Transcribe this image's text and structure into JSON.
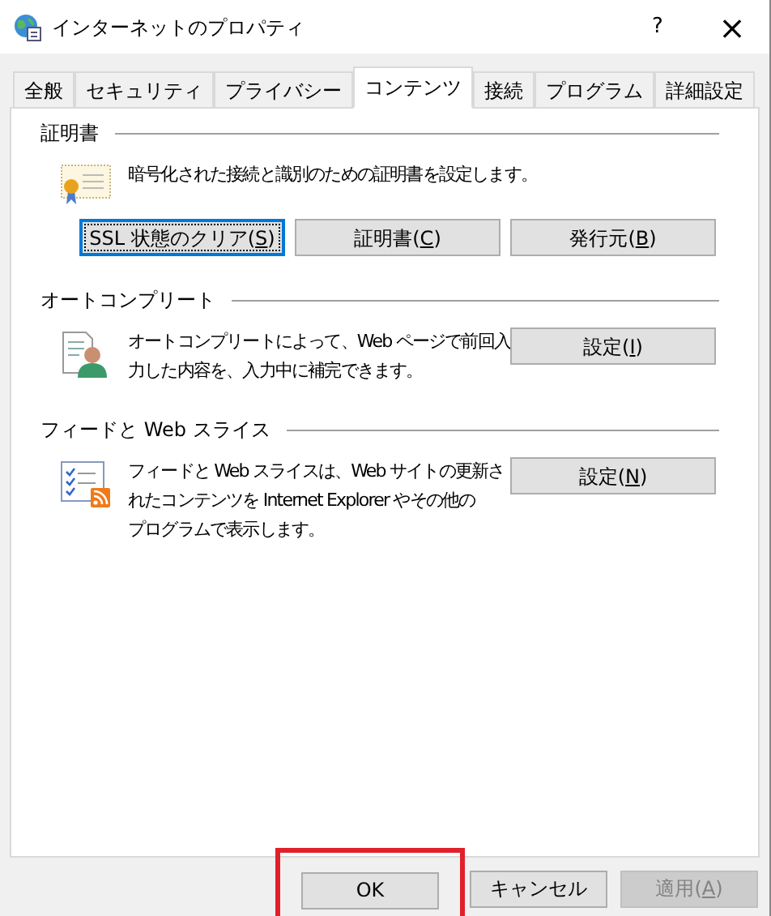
{
  "window": {
    "title": "インターネットのプロパティ",
    "help": "?",
    "close": "×"
  },
  "tabs": [
    {
      "label": "全般",
      "selected": false
    },
    {
      "label": "セキュリティ",
      "selected": false
    },
    {
      "label": "プライバシー",
      "selected": false
    },
    {
      "label": "コンテンツ",
      "selected": true
    },
    {
      "label": "接続",
      "selected": false
    },
    {
      "label": "プログラム",
      "selected": false
    },
    {
      "label": "詳細設定",
      "selected": false
    }
  ],
  "sections": [
    {
      "kind": "certificate",
      "title": "証明書",
      "description": [
        "暗号化された接続と識別のための証明書を設定します。"
      ],
      "buttons": [
        {
          "before": "SSL 状態のクリア(",
          "key": "S",
          "after": ")",
          "focused": true
        },
        {
          "before": "証明書(",
          "key": "C",
          "after": ")",
          "focused": false
        },
        {
          "before": "発行元(",
          "key": "B",
          "after": ")",
          "focused": false
        }
      ]
    },
    {
      "kind": "autocomplete",
      "title": "オートコンプリート",
      "description": [
        "オートコンプリートによって、Web ページで前回入",
        "力した内容を、入力中に補完できます。"
      ],
      "buttons": [
        {
          "before": "設定(",
          "key": "I",
          "after": ")",
          "focused": false
        }
      ]
    },
    {
      "kind": "feeds",
      "title": "フィードと Web スライス",
      "description": [
        "フィードと Web スライスは、Web サイトの更新さ",
        "れたコンテンツを Internet Explorer やその他の",
        "プログラムで表示します。"
      ],
      "buttons": [
        {
          "before": "設定(",
          "key": "N",
          "after": ")",
          "focused": false
        }
      ]
    }
  ],
  "footer_buttons": [
    {
      "label": "OK",
      "disabled": false,
      "highlighted": true
    },
    {
      "label": "キャンセル",
      "disabled": false,
      "highlighted": false
    },
    {
      "before": "適用(",
      "key": "A",
      "after": ")",
      "disabled": true,
      "highlighted": false
    }
  ]
}
